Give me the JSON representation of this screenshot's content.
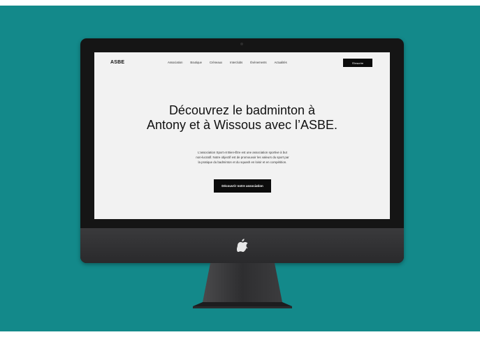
{
  "site": {
    "logo": "ASBE",
    "nav": [
      "Association",
      "Boutique",
      "Créneaux",
      "Interclubs",
      "Évènements",
      "Actualités"
    ],
    "cta": "S'inscrire"
  },
  "hero": {
    "title_lines": [
      "Découvrez le badminton à",
      "Antony et à Wissous avec l’ASBE."
    ],
    "text_lines": [
      "L’association Sport et Bien-Être est une association sportive à but",
      "non-lucratif. Notre objectif est de promouvoir les valeurs du sport par",
      "la pratique du badminton et du squash en loisir et en compétition."
    ],
    "button": "Découvrir notre association"
  },
  "colors": {
    "background": "#13898a",
    "bezel": "#151515",
    "chin": "#333335",
    "screen": "#f2f2f2",
    "button": "#0c0c0c"
  },
  "icons": {
    "device_logo": "apple-icon"
  }
}
